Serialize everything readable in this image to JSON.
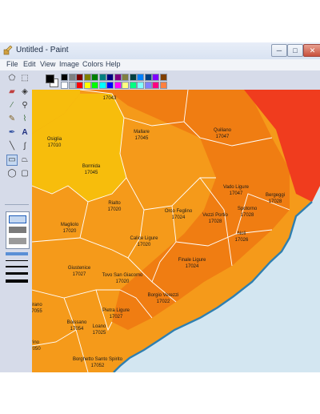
{
  "window": {
    "title": "Untitled - Paint",
    "minimize_glyph": "─",
    "maximize_glyph": "□",
    "close_glyph": "✕"
  },
  "menu": [
    "File",
    "Edit",
    "View",
    "Image",
    "Colors",
    "Help"
  ],
  "tools": [
    "free-form-select-icon",
    "select-icon",
    "eraser-icon",
    "fill-icon",
    "color-picker-icon",
    "magnifier-icon",
    "pencil-icon",
    "brush-icon",
    "airbrush-icon",
    "text-icon",
    "line-icon",
    "curve-icon",
    "rectangle-icon",
    "polygon-icon",
    "ellipse-icon",
    "rounded-rectangle-icon"
  ],
  "palette": {
    "foreground": "#000000",
    "background": "#ffffff",
    "colors": [
      "#000000",
      "#808080",
      "#800000",
      "#808000",
      "#008000",
      "#008080",
      "#000080",
      "#800080",
      "#808040",
      "#004040",
      "#0080ff",
      "#004080",
      "#8000ff",
      "#804000",
      "#ffffff",
      "#c0c0c0",
      "#ff0000",
      "#ffff00",
      "#00ff00",
      "#00ffff",
      "#0000ff",
      "#ff00ff",
      "#ffff80",
      "#00ff80",
      "#80ffff",
      "#8080ff",
      "#ff0080",
      "#ff8040"
    ]
  },
  "map": {
    "colors": {
      "sea": "#d3e6f1",
      "coast": "#2f7fb0",
      "dark_orange": "#f07d12",
      "orange": "#f59a1a",
      "yellow": "#f7bd0c",
      "red": "#f03c1e"
    },
    "places": [
      {
        "name": "",
        "code": "17043"
      },
      {
        "name": "Osiglia",
        "code": "17010"
      },
      {
        "name": "Mallare",
        "code": "17045"
      },
      {
        "name": "Quiliano",
        "code": "17047"
      },
      {
        "name": "Bormida",
        "code": "17045"
      },
      {
        "name": "Vado Ligure",
        "code": "17047"
      },
      {
        "name": "Bergeggi",
        "code": "17028"
      },
      {
        "name": "Rialto",
        "code": "17020"
      },
      {
        "name": "Orco Feglino",
        "code": "17024"
      },
      {
        "name": "Vezzi Portio",
        "code": "17028"
      },
      {
        "name": "Spotorno",
        "code": "17028"
      },
      {
        "name": "Magliolo",
        "code": "17020"
      },
      {
        "name": "Calice Ligure",
        "code": "17020"
      },
      {
        "name": "Noli",
        "code": "17026"
      },
      {
        "name": "Finale Ligure",
        "code": "17024"
      },
      {
        "name": "Giustenice",
        "code": "17027"
      },
      {
        "name": "Tovo San Giacomo",
        "code": "17020"
      },
      {
        "name": "Borgio Verezzi",
        "code": "17022"
      },
      {
        "name": "irano",
        "code": "7055"
      },
      {
        "name": "Pietra Ligure",
        "code": "17027"
      },
      {
        "name": "Boissano",
        "code": "17054"
      },
      {
        "name": "Loano",
        "code": "17025"
      },
      {
        "name": "rino",
        "code": "7050"
      },
      {
        "name": "Borghetto Santo Spirito",
        "code": "17052"
      }
    ]
  }
}
